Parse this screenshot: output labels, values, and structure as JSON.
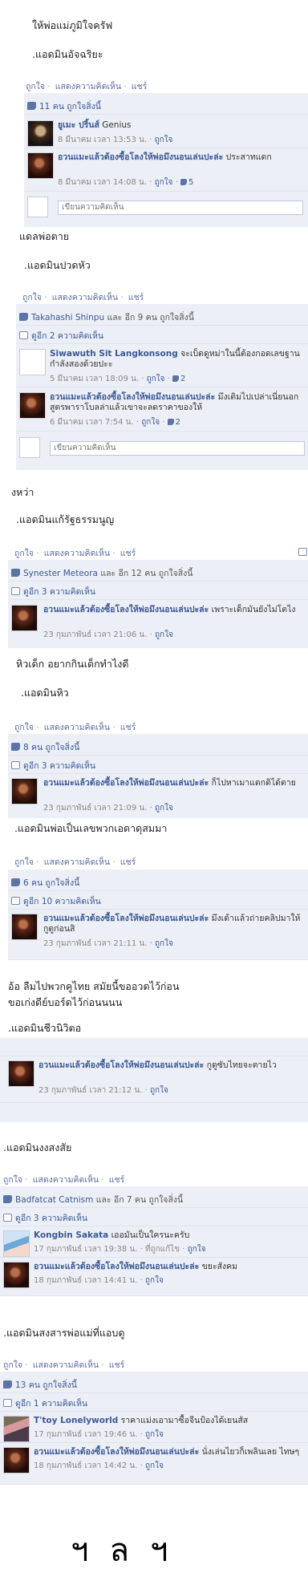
{
  "s1": {
    "text_top": "ให้พ่อแม่ภูมิใจครัฟ",
    "text_admin": ".แอดมินอัจฉริยะ",
    "actions": [
      "ถูกใจ",
      "แสดงความคิดเห็น",
      "แชร์"
    ],
    "likes": "11 คน ถูกใจสิ่งนี้",
    "comments": [
      {
        "name": "ยูเมะ ปริ้นส์",
        "text": "Genius",
        "time": "8 มีนาคม เวลา 13:53 น.",
        "like": "ถูกใจ"
      },
      {
        "name": "อวนแมะแล้วต้องซื้อโลงให้พ่อมึงนอนเล่นปะล่ะ",
        "text": "ประสาทแดก",
        "time": "8 มีนาคม เวลา 14:08 น.",
        "like": "ถูกใจ",
        "like_count": "5"
      }
    ],
    "write_placeholder": "เขียนความคิดเห็น"
  },
  "s2": {
    "text_top": "แดลพ่อตาย",
    "text_admin": ".แอดมินปวดหัว",
    "actions": [
      "ถูกใจ",
      "แสดงความคิดเห็น",
      "แชร์"
    ],
    "likes_name": "Takahashi Shinpu",
    "likes_rest": "และ อีก 9 คน ถูกใจสิ่งนี้",
    "view_comments": "ดูอีก 2 ความคิดเห็น",
    "comments": [
      {
        "name": "Siwawuth Sit Langkonsong",
        "text": "จะเบ็ดดูหม่าในนี้ต้องกอดเลขฐานกำลังสองด้วยปะะ",
        "time": "5 มีนาคม เวลา 18:09 น.",
        "like": "ถูกใจ",
        "like_count": "2"
      },
      {
        "name": "อวนแมะแล้วต้องซื้อโลงให้พ่อมึงนอนเล่นปะล่ะ",
        "text": "มึงเติมไปเปล่าเนี่ยนอกสูตรพาราโบลล่าแล้วเขาจะลดราคาของให้",
        "time": "6 มีนาคม เวลา 7:54 น.",
        "like": "ถูกใจ",
        "like_count": "2"
      }
    ],
    "write_placeholder": "เขียนความคิดเห็น"
  },
  "s3": {
    "text_top": "งหว่า",
    "text_admin": ".แอดมินแก้รัฐธรรมนูญ",
    "actions": [
      "ถูกใจ",
      "แสดงความคิดเห็น",
      "แชร์"
    ],
    "likes_name": "Synester Meteora",
    "likes_rest": "และ อีก 12 คน ถูกใจสิ่งนี้",
    "view_comments": "ดูอีก 3 ความคิดเห็น",
    "comment": {
      "name": "อวนแมะแล้วต้องซื้อโลงให้พ่อมึงนอนเล่นปะล่ะ",
      "text": "เพราะเด็กมันยังไม่โตไง",
      "time": "23 กุมภาพันธ์ เวลา 21:06 น.",
      "like": "ถูกใจ"
    }
  },
  "s4": {
    "text_top": "หิวเด็ก อยากกินเด็กทำไงดี",
    "text_admin": ".แอดมินหิว",
    "actions": [
      "ถูกใจ",
      "แสดงความคิดเห็น",
      "แชร์"
    ],
    "likes": "8 คน ถูกใจสิ่งนี้",
    "view_comments": "ดูอีก 3 ความคิดเห็น",
    "comment": {
      "name": "อวนแมะแล้วต้องซื้อโลงให้พ่อมึงนอนเล่นปะล่ะ",
      "text": "ก็ไปหาเมาแดกดิได้ตาย",
      "time": "23 กุมภาพันธ์ เวลา 21:09 น.",
      "like": "ถูกใจ"
    }
  },
  "s5": {
    "text_admin": ".แอดมินพ่อเป็นเลขพวกเอดาดุสมมา",
    "actions": [
      "ถูกใจ",
      "แสดงความคิดเห็น",
      "แชร์"
    ],
    "likes": "6 คน ถูกใจสิ่งนี้",
    "view_comments": "ดูอีก 10 ความคิดเห็น",
    "comment": {
      "name": "อวนแมะแล้วต้องซื้อโลงให้พ่อมึงนอนเล่นปะล่ะ",
      "text": "มึงเด้าแล้วถ่ายคลิปมาให้กูดูก่อนสิ",
      "time": "23 กุมภาพันธ์ เวลา 21:11 น.",
      "like": "ถูกใจ"
    }
  },
  "s6": {
    "text_line1": "อ้อ ลืมไปพวกคูไทย สมัยนี้ขออวดไว้ก่อน",
    "text_line2": "ขอเก่งดีย์บอร์ดไว้ก่อนนนน",
    "text_admin": ".แอดมินชีวนิวิตอ",
    "comment": {
      "name": "อวนแมะแล้วต้องซื้อโลงให้พ่อมึงนอนเล่นปะล่ะ",
      "text": "กูดูซับไทยจะตายไว",
      "time": "23 กุมภาพันธ์ เวลา 21:12 น.",
      "like": "ถูกใจ"
    }
  },
  "s7": {
    "text_admin": ".แอดมินงงสงสัย",
    "actions": [
      "ถูกใจ",
      "แสดงความคิดเห็น",
      "แชร์"
    ],
    "likes_name": "Badfatcat Catnism",
    "likes_rest": "และ อีก 7 คน ถูกใจสิ่งนี้",
    "view_comments": "ดูอีก 3 ความคิดเห็น",
    "comments": [
      {
        "name": "Kongbin Sakata",
        "text": "เออมันเป็นใครนะครับ",
        "time": "17 กุมภาพันธ์ เวลา 19:38 น.",
        "via": "ที่ถูกแก้ไข",
        "like": "ถูกใจ"
      },
      {
        "name": "อวนแมะแล้วต้องซื้อโลงให้พ่อมึงนอนเล่นปะล่ะ",
        "text": "ขยะสังคม",
        "time": "18 กุมภาพันธ์ เวลา 14:41 น.",
        "like": "ถูกใจ"
      }
    ]
  },
  "s8": {
    "text_admin": ".แอดมินสงสารพ่อแม่ที่แอบดู",
    "actions": [
      "ถูกใจ",
      "แสดงความคิดเห็น",
      "แชร์"
    ],
    "likes": "13 คน ถูกใจสิ่งนี้",
    "view_comments": "ดูอีก 1 ความคิดเห็น",
    "comments": [
      {
        "name": "T'toy Lonelyworld",
        "text": "ราคาแม่งเอามาซื้อจีนป้องได้เยนสัส",
        "time": "17 กุมภาพันธ์ เวลา 19:46 น.",
        "like": "ถูกใจ"
      },
      {
        "name": "อวนแมะแล้วต้องซื้อโลงให้พ่อมึงนอนเล่นปะล่ะ",
        "text": "นั่งเล่นไยวก็เพลินเลย ไทษๆ",
        "time": "18 กุมภาพันธ์ เวลา 14:42 น.",
        "like": "ถูกใจ"
      }
    ]
  },
  "signature": "ฯลฯ"
}
